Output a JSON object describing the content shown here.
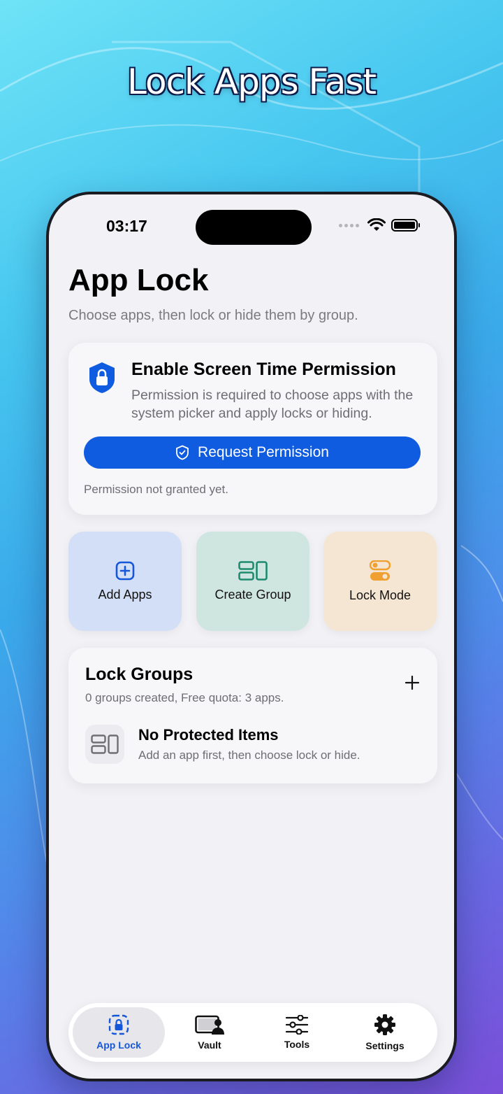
{
  "headline": "Lock Apps Fast",
  "status_bar": {
    "time": "03:17"
  },
  "page": {
    "title": "App Lock",
    "subtitle": "Choose apps, then lock or hide them by group."
  },
  "permission_card": {
    "title": "Enable Screen Time Permission",
    "description": "Permission is required to choose apps with the system picker and apply locks or hiding.",
    "button_label": "Request Permission",
    "status": "Permission not granted yet."
  },
  "quick_actions": [
    {
      "label": "Add Apps",
      "icon": "plus-square-icon"
    },
    {
      "label": "Create Group",
      "icon": "group-icon"
    },
    {
      "label": "Lock Mode",
      "icon": "toggles-icon"
    }
  ],
  "lock_groups": {
    "title": "Lock Groups",
    "subtitle": "0 groups created, Free quota: 3 apps.",
    "empty_title": "No Protected Items",
    "empty_desc": "Add an app first, then choose lock or hide."
  },
  "tabs": [
    {
      "label": "App Lock",
      "icon": "app-lock-icon"
    },
    {
      "label": "Vault",
      "icon": "vault-icon"
    },
    {
      "label": "Tools",
      "icon": "sliders-icon"
    },
    {
      "label": "Settings",
      "icon": "gear-icon"
    }
  ],
  "colors": {
    "accent": "#0f5ce0",
    "add_tile": "#d3dff6",
    "group_tile": "#cfe6e0",
    "mode_tile": "#f5e6d3",
    "group_icon": "#1e8a6e",
    "mode_icon": "#f0a030"
  }
}
